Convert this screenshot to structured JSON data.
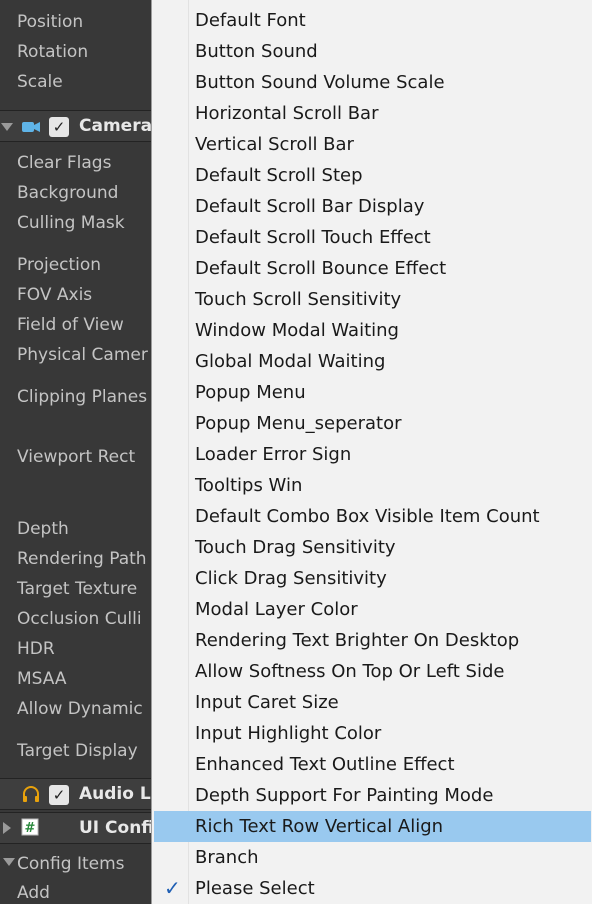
{
  "inspector": {
    "transform_props": [
      "Position",
      "Rotation",
      "Scale"
    ],
    "camera": {
      "title": "Camera",
      "enabled": true,
      "icon": "camera-icon",
      "props": {
        "clear_flags": "Clear Flags",
        "background": "Background",
        "culling_mask": "Culling Mask",
        "projection": "Projection",
        "fov_axis": "FOV Axis",
        "field_of_view": "Field of View",
        "physical_camera": "Physical Camer",
        "clipping_planes": "Clipping Planes",
        "viewport_rect": "Viewport Rect",
        "depth": "Depth",
        "rendering_path": "Rendering Path",
        "target_texture": "Target Texture",
        "occlusion_culling": "Occlusion Culli",
        "hdr": "HDR",
        "msaa": "MSAA",
        "allow_dynamic": "Allow Dynamic",
        "target_display": "Target Display"
      }
    },
    "audio_listener": {
      "title": "Audio Li",
      "enabled": true,
      "icon": "headphones-icon"
    },
    "ui_config": {
      "title": "UI Confi",
      "icon": "script-hash-icon"
    },
    "config_items": {
      "label": "Config Items"
    },
    "add_label": "Add"
  },
  "menu": {
    "items": [
      "Default Font",
      "Button Sound",
      "Button Sound Volume Scale",
      "Horizontal Scroll Bar",
      "Vertical Scroll Bar",
      "Default Scroll Step",
      "Default Scroll Bar Display",
      "Default Scroll Touch Effect",
      "Default Scroll Bounce Effect",
      "Touch Scroll Sensitivity",
      "Window Modal Waiting",
      "Global Modal Waiting",
      "Popup Menu",
      "Popup Menu_seperator",
      "Loader Error Sign",
      "Tooltips Win",
      "Default Combo Box Visible Item Count",
      "Touch Drag Sensitivity",
      "Click Drag Sensitivity",
      "Modal Layer Color",
      "Rendering Text Brighter On Desktop",
      "Allow Softness On Top Or Left Side",
      "Input Caret Size",
      "Input Highlight Color",
      "Enhanced Text Outline Effect",
      "Depth Support For Painting Mode",
      "Rich Text Row Vertical Align",
      "Branch",
      "Please Select"
    ],
    "highlighted_index": 26,
    "checked_index": 28,
    "highlight_color": "#99c9ef",
    "check_icon": "checkmark-icon"
  }
}
